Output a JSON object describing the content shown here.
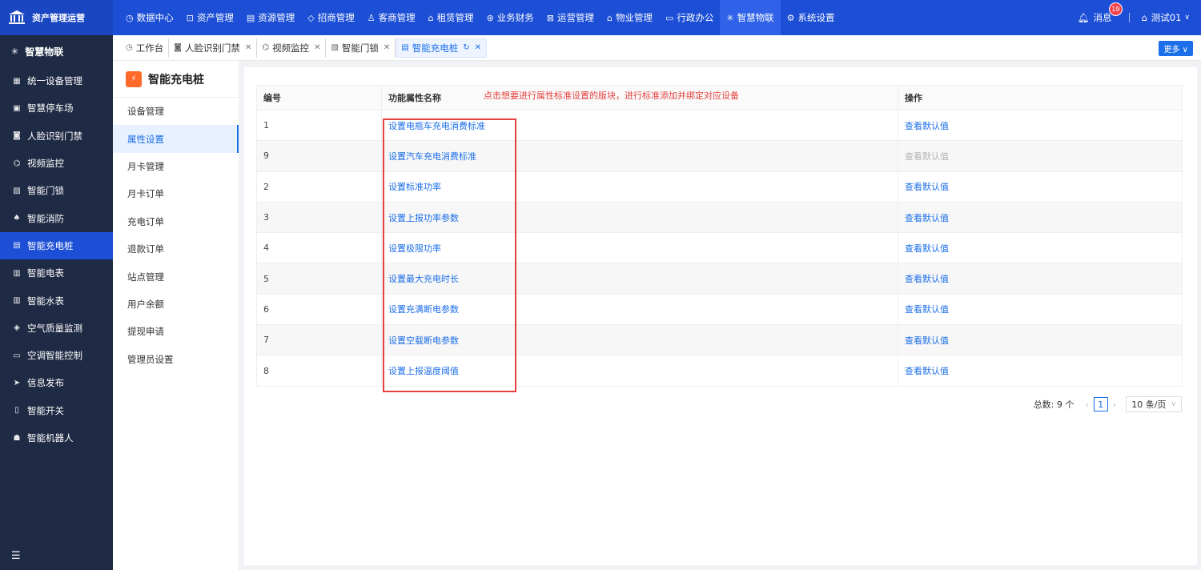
{
  "brand": {
    "name": "资产管理运营"
  },
  "nav": [
    {
      "label": "数据中心",
      "icon": "◷"
    },
    {
      "label": "资产管理",
      "icon": "⊡"
    },
    {
      "label": "资源管理",
      "icon": "▤"
    },
    {
      "label": "招商管理",
      "icon": "◇"
    },
    {
      "label": "客商管理",
      "icon": "♙"
    },
    {
      "label": "租赁管理",
      "icon": "⌂"
    },
    {
      "label": "业务财务",
      "icon": "⊛"
    },
    {
      "label": "运营管理",
      "icon": "⊠"
    },
    {
      "label": "物业管理",
      "icon": "⌂"
    },
    {
      "label": "行政办公",
      "icon": "▭"
    },
    {
      "label": "智慧物联",
      "icon": "✳"
    },
    {
      "label": "系统设置",
      "icon": "⚙"
    }
  ],
  "header": {
    "messages_label": "消息",
    "message_count": "19",
    "user_name": "测试01"
  },
  "sidebar": {
    "title": "智慧物联",
    "items": [
      {
        "label": "统一设备管理",
        "icon": "▦"
      },
      {
        "label": "智慧停车场",
        "icon": "▣"
      },
      {
        "label": "人脸识别门禁",
        "icon": "◙"
      },
      {
        "label": "视频监控",
        "icon": "⌬"
      },
      {
        "label": "智能门锁",
        "icon": "▧"
      },
      {
        "label": "智能消防",
        "icon": "♠"
      },
      {
        "label": "智能充电桩",
        "icon": "▤"
      },
      {
        "label": "智能电表",
        "icon": "▥"
      },
      {
        "label": "智能水表",
        "icon": "▥"
      },
      {
        "label": "空气质量监测",
        "icon": "◈"
      },
      {
        "label": "空调智能控制",
        "icon": "▭"
      },
      {
        "label": "信息发布",
        "icon": "➤"
      },
      {
        "label": "智能开关",
        "icon": "▯"
      },
      {
        "label": "智能机器人",
        "icon": "☗"
      }
    ]
  },
  "tabs": [
    {
      "label": "工作台",
      "icon": "◷"
    },
    {
      "label": "人脸识别门禁",
      "icon": "◙"
    },
    {
      "label": "视频监控",
      "icon": "⌬"
    },
    {
      "label": "智能门锁",
      "icon": "▧"
    },
    {
      "label": "智能充电桩",
      "icon": "▤"
    }
  ],
  "more_label": "更多",
  "subpanel": {
    "title": "智能充电桩",
    "items": [
      "设备管理",
      "属性设置",
      "月卡管理",
      "月卡订单",
      "充电订单",
      "退款订单",
      "站点管理",
      "用户余额",
      "提现申请",
      "管理员设置"
    ]
  },
  "table": {
    "note": "点击想要进行属性标准设置的版块，进行标准添加并绑定对应设备",
    "headers": [
      "编号",
      "功能属性名称",
      "操作"
    ],
    "rows": [
      {
        "id": "1",
        "name": "设置电瓶车充电消费标准",
        "action": "查看默认值",
        "disabled": false
      },
      {
        "id": "9",
        "name": "设置汽车充电消费标准",
        "action": "查看默认值",
        "disabled": true
      },
      {
        "id": "2",
        "name": "设置标准功率",
        "action": "查看默认值",
        "disabled": false
      },
      {
        "id": "3",
        "name": "设置上报功率参数",
        "action": "查看默认值",
        "disabled": false
      },
      {
        "id": "4",
        "name": "设置极限功率",
        "action": "查看默认值",
        "disabled": false
      },
      {
        "id": "5",
        "name": "设置最大充电时长",
        "action": "查看默认值",
        "disabled": false
      },
      {
        "id": "6",
        "name": "设置充满断电参数",
        "action": "查看默认值",
        "disabled": false
      },
      {
        "id": "7",
        "name": "设置空载断电参数",
        "action": "查看默认值",
        "disabled": false
      },
      {
        "id": "8",
        "name": "设置上报温度阈值",
        "action": "查看默认值",
        "disabled": false
      }
    ]
  },
  "pagination": {
    "total_label": "总数: 9 个",
    "current_page": "1",
    "page_size": "10 条/页"
  }
}
